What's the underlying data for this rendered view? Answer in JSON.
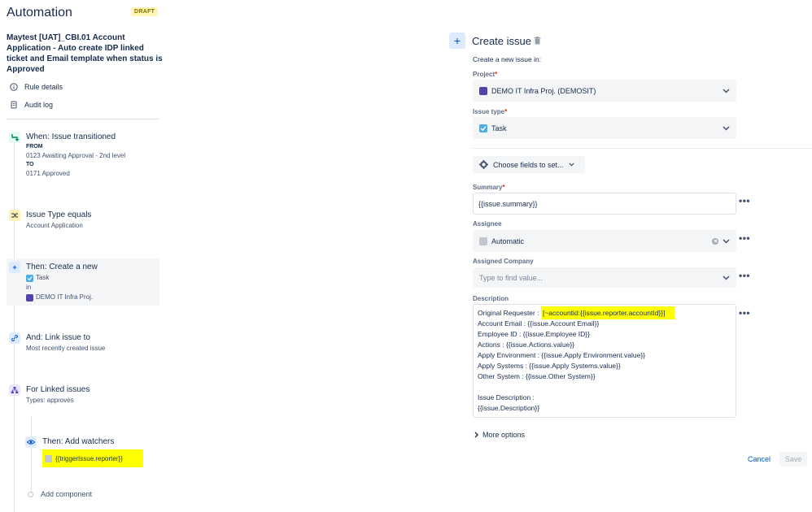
{
  "header": {
    "title": "Automation",
    "badge": "DRAFT"
  },
  "rule": {
    "name": "Maytest [UAT]_CBI.01 Account Application - Auto create IDP linked ticket and Email template when status is Approved"
  },
  "nav": [
    {
      "label": "Rule details",
      "icon": "info-icon"
    },
    {
      "label": "Audit log",
      "icon": "document-icon"
    }
  ],
  "components": {
    "trigger": {
      "title": "When: Issue transitioned",
      "from_label": "FROM",
      "from_value": "0123 Awaiting Approval - 2nd level",
      "to_label": "TO",
      "to_value": "0171 Approved"
    },
    "condition": {
      "title": "Issue Type equals",
      "sub": "Account Application"
    },
    "action_create": {
      "title": "Then: Create a new",
      "type": "Task",
      "in_label": "in",
      "project": "DEMO IT Infra Proj."
    },
    "action_link": {
      "title": "And: Link issue to",
      "sub": "Most recently created issue"
    },
    "branch": {
      "title": "For Linked issues",
      "sub": "Types: approves"
    },
    "watchers": {
      "title": "Then: Add watchers",
      "value": "{{triggerIssue.reporter}}"
    },
    "add_component": "Add component"
  },
  "form": {
    "title": "Create issue",
    "create_in_label": "Create a new issue in:",
    "project_label": "Project",
    "project_value": "DEMO IT Infra Proj. (DEMOSIT)",
    "issue_type_label": "Issue type",
    "issue_type_value": "Task",
    "choose_fields": "Choose fields to set...",
    "summary_label": "Summary",
    "summary_value": "{{issue.summary}}",
    "assignee_label": "Assignee",
    "assignee_value": "Automatic",
    "company_label": "Assigned Company",
    "company_placeholder": "Type to find value...",
    "description_label": "Description",
    "description": {
      "requester_prefix": "Original Requester : ",
      "requester_value": "[~accountid:{{issue.reporter.accountId}}]",
      "lines": [
        "Account Email : {{issue.Account Email}}",
        "Employee ID : {{issue.Employee ID}}",
        "Actions : {{issue.Actions.value}}",
        "Apply Environment : {{issue.Apply Environment.value}}",
        "Apply Systems : {{issue.Apply Systems.value}}",
        "Other System : {{issue.Other System}}",
        "",
        "Issue Description :",
        "{{issue.Description}}"
      ]
    },
    "more_options": "More options",
    "cancel": "Cancel",
    "save": "Save",
    "required_mark": "*"
  },
  "colors": {
    "accent": "#0052cc",
    "highlight": "#ffff00",
    "draft_bg": "#fff6b3"
  }
}
